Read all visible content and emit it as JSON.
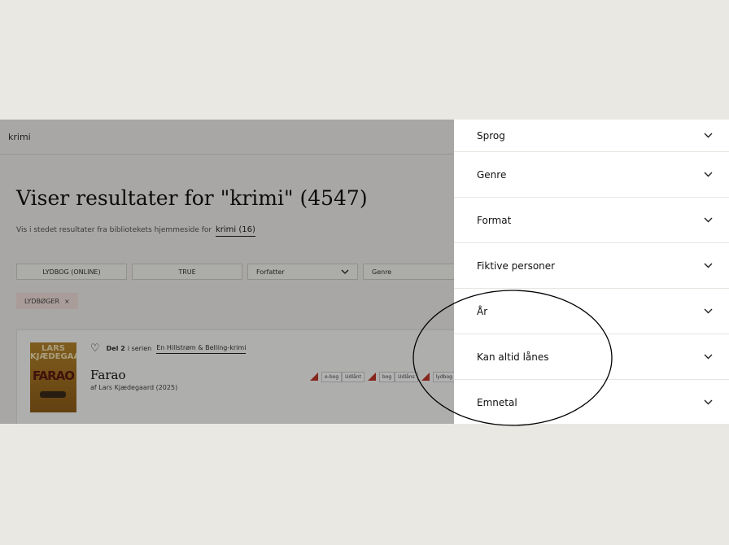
{
  "search": {
    "query": "krimi"
  },
  "results": {
    "headline": "Viser resultater for \"krimi\" (4547)",
    "alt_text": "Vis i stedet resultater fra bibliotekets hjemmeside for",
    "alt_link": "krimi (16)"
  },
  "filters": {
    "chips": [
      {
        "label": "LYDBOG (ONLINE)"
      },
      {
        "label": "TRUE"
      }
    ],
    "selects": [
      {
        "label": "Forfatter"
      },
      {
        "label": "Genre"
      }
    ],
    "active_tag": "LYDBØGER",
    "remove_icon": "×"
  },
  "result_card": {
    "cover": {
      "author_text": "LARS KJÆDEGAARD",
      "title_text": "FARAO"
    },
    "series_part": "Del 2",
    "series_in": "i serien",
    "series_name": "En Hillstrøm & Belling-krimi",
    "title": "Farao",
    "author_line": "af Lars Kjædegaard (2025)",
    "availability": [
      {
        "type": "e-bog",
        "status": "Udlånt"
      },
      {
        "type": "bog",
        "status": "Udlåns"
      },
      {
        "type": "lydbog (o",
        "status": ""
      }
    ]
  },
  "facets": [
    {
      "label": "Sprog"
    },
    {
      "label": "Genre"
    },
    {
      "label": "Format"
    },
    {
      "label": "Fiktive personer"
    },
    {
      "label": "År"
    },
    {
      "label": "Kan altid lånes"
    },
    {
      "label": "Emnetal"
    }
  ],
  "colors": {
    "background": "#e9e8e3",
    "availability_marker": "#c0392b",
    "active_tag_bg": "#f4e1dc"
  }
}
